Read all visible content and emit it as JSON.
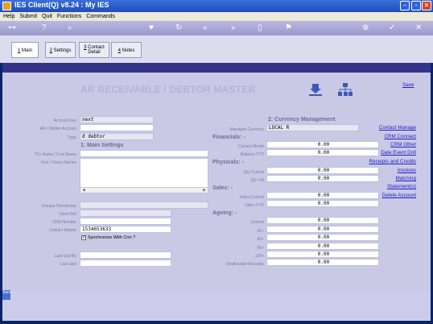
{
  "window": {
    "title": "IES Client(Q) v8.24 : My IES"
  },
  "menu": [
    "Help",
    "Submit",
    "Quit",
    "Functions",
    "Commands"
  ],
  "tabs": [
    {
      "num": "1",
      "label": "Main"
    },
    {
      "num": "2",
      "label": "Settings"
    },
    {
      "num": "3",
      "label": "Contact Detail"
    },
    {
      "num": "4",
      "label": "Notes"
    }
  ],
  "page_title": "AR RECEIVABLE / DEBTOR MASTER",
  "save_label": "Save",
  "left": {
    "account_key": {
      "label": "Account Key",
      "value": "next"
    },
    "ar_debtor_account": {
      "label": "AR / Debtor Account",
      "value": ""
    },
    "type": {
      "label": "Type",
      "value": "d debtor"
    },
    "main_settings": "1: Main Settings",
    "co_name": {
      "label": "*Co Name / Cust Name",
      "value": ""
    },
    "first_names": {
      "label": "First / Given Names",
      "value": ""
    },
    "cheque_beneficiary": {
      "label": "Cheque Beneficiary",
      "value": ""
    },
    "client_ref": {
      "label": "Client Ref",
      "value": ""
    },
    "crm_number": {
      "label": "CRM Number",
      "value": ""
    },
    "contact_master": {
      "label": "Contact Master",
      "value": "1534653633"
    },
    "sync_crm": {
      "label": "Synchronize With Crm ?",
      "checked": true
    },
    "last_upd_by": {
      "label": "Last Upd By",
      "value": ""
    },
    "last_upd": {
      "label": "Last Upd",
      "value": ""
    }
  },
  "right": {
    "currency_heading": "2: Currency Management",
    "managed_currency": {
      "label": "Managed Currency",
      "value": "LOCAL R"
    },
    "financials": "Financials: -",
    "current_month": {
      "label": "Current Month",
      "value": "0.00"
    },
    "balance_ytd": {
      "label": "Balance YTD",
      "value": "0.00"
    },
    "physicals": "Physicals: -",
    "qty_current": {
      "label": "Qty Current",
      "value": "0.00"
    },
    "qty_ytd": {
      "label": "Qty Ytd",
      "value": "0.00"
    },
    "sales": "Sales: -",
    "sales_current": {
      "label": "Sales Current",
      "value": "0.00"
    },
    "sales_ytd": {
      "label": "Sales YTD",
      "value": "0.00"
    },
    "ageing": "Ageing: -",
    "current": {
      "label": "Current",
      "value": "0.00"
    },
    "d30": {
      "label": "30+",
      "value": "0.00"
    },
    "d60": {
      "label": "60+",
      "value": "0.00"
    },
    "d90": {
      "label": "90+",
      "value": "0.00"
    },
    "d120": {
      "label": "120+",
      "value": "0.00"
    },
    "unallocated": {
      "label": "Unallocated Receipts",
      "value": "0.00"
    }
  },
  "links": [
    "Contact Manage",
    "CRM Connect",
    "CRM Other",
    "Date Event Drill",
    "Receipts and Credits",
    "Invoices",
    "Matching",
    "Statement(s)",
    "Delete Account"
  ],
  "bottom_tag": "Serv"
}
